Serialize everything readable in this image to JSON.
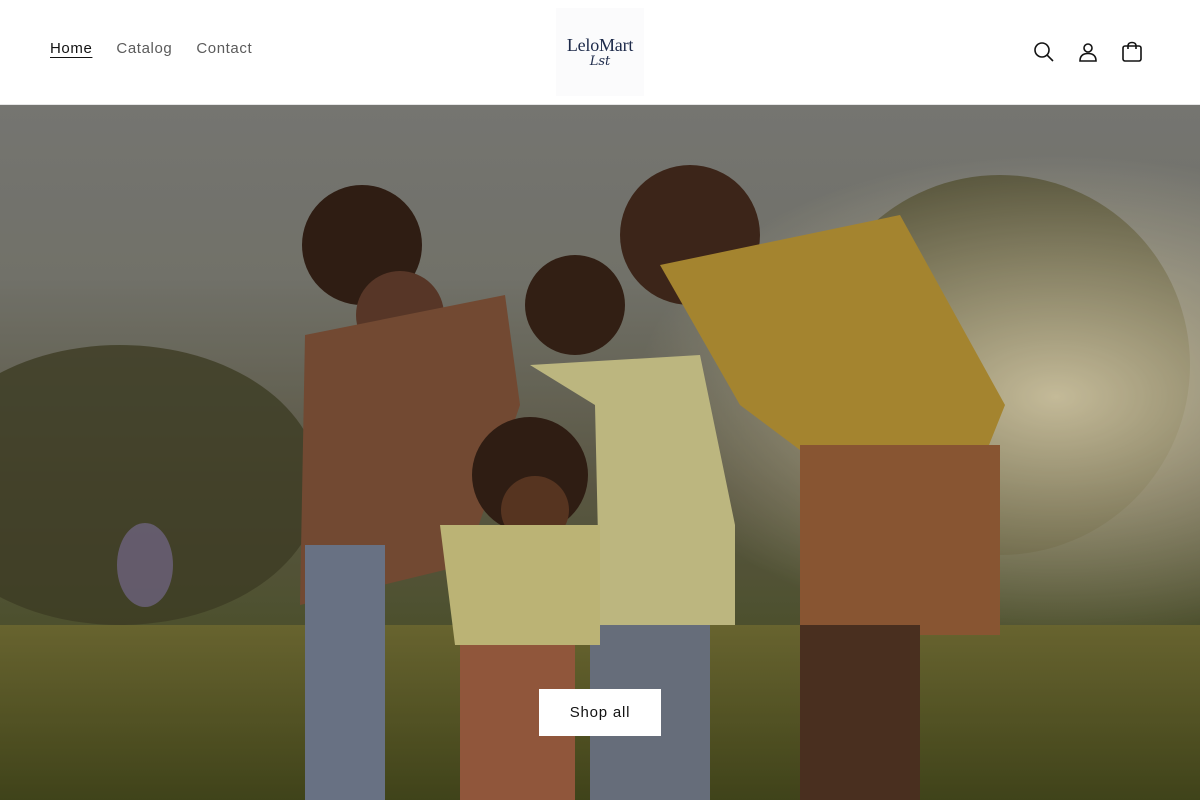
{
  "nav": {
    "items": [
      {
        "label": "Home",
        "active": true
      },
      {
        "label": "Catalog",
        "active": false
      },
      {
        "label": "Contact",
        "active": false
      }
    ]
  },
  "logo": {
    "name": "LeloMart",
    "sub": "Lst"
  },
  "header_icons": [
    "search-icon",
    "account-icon",
    "cart-icon"
  ],
  "hero": {
    "image": "family playing outdoors in a sunlit field",
    "cta_label": "Shop all"
  },
  "colors": {
    "text": "#121212",
    "muted_text": "#5b5b5b",
    "logo": "#1d2a4a",
    "button_bg": "#ffffff"
  }
}
